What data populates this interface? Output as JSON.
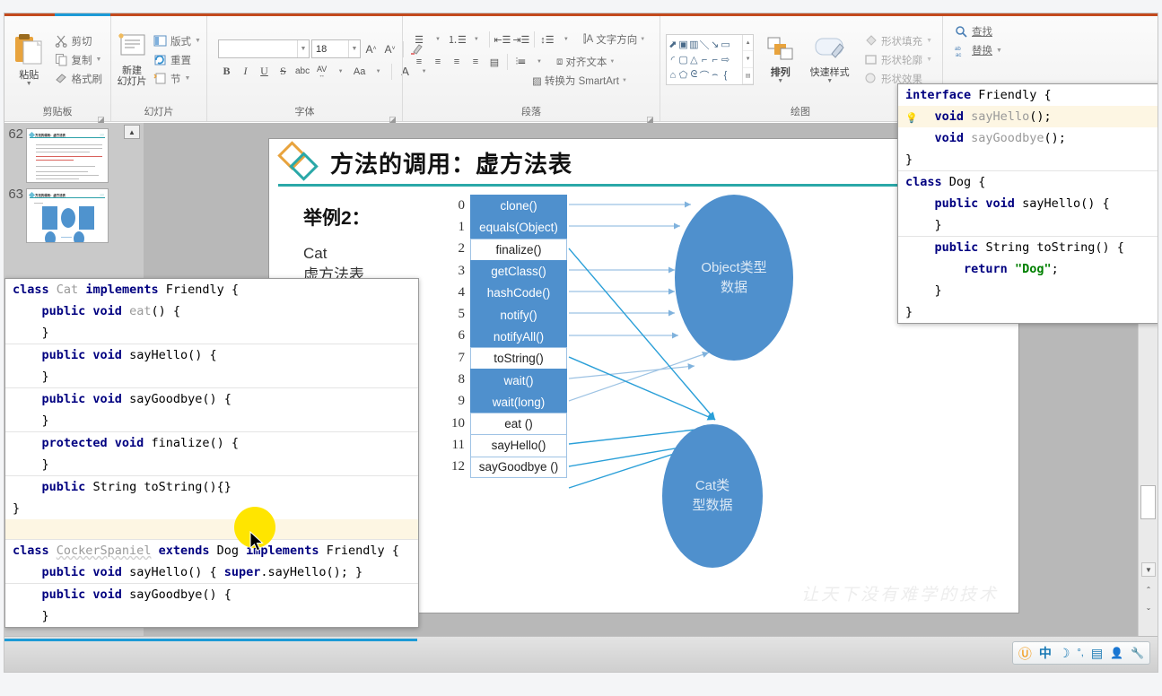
{
  "ribbon": {
    "groups": [
      {
        "name": "clipboard",
        "label": "剪贴板",
        "paste": {
          "label": "粘贴",
          "icon": "clipboard-icon"
        },
        "items": [
          {
            "label": "剪切",
            "icon": "scissors-icon",
            "has_caret": false
          },
          {
            "label": "复制",
            "icon": "copy-icon",
            "has_caret": true
          },
          {
            "label": "格式刷",
            "icon": "format-painter-icon",
            "has_caret": false
          }
        ]
      },
      {
        "name": "slides",
        "label": "幻灯片",
        "new_slide": {
          "label": "新建\n幻灯片",
          "icon": "new-slide-icon"
        },
        "items": [
          {
            "label": "版式",
            "icon": "layout-icon",
            "has_caret": true
          },
          {
            "label": "重置",
            "icon": "reset-icon",
            "has_caret": false
          },
          {
            "label": "节",
            "icon": "section-icon",
            "has_caret": true
          }
        ]
      },
      {
        "name": "font",
        "label": "字体",
        "font_name": "",
        "font_size": "18",
        "buttons_row1": [
          "A˄",
          "A˅",
          "✀"
        ],
        "buttons_row2": [
          "B",
          "I",
          "U",
          "S",
          "abc",
          "AV",
          "Aa",
          "A"
        ]
      },
      {
        "name": "paragraph",
        "label": "段落",
        "text_direction": "文字方向",
        "align_text": "对齐文本",
        "convert_smartart": "转换为 SmartArt"
      },
      {
        "name": "drawing",
        "label": "绘图",
        "arrange": "排列",
        "quick_styles": "快速样式",
        "shape_fill": "形状填充",
        "shape_outline": "形状轮廓",
        "shape_effects": "形状效果"
      },
      {
        "name": "editing",
        "find": "查找",
        "replace": "替换"
      }
    ]
  },
  "thumbnails": [
    {
      "number": "62",
      "title": "方法的调用：虚方法表",
      "kind": "text"
    },
    {
      "number": "63",
      "title": "方法的调用：虚方法表",
      "kind": "diagram"
    }
  ],
  "slide": {
    "title": "方法的调用：虚方法表",
    "example_label": "举例2：",
    "example_sub": "Cat\n虚方法表",
    "watermark": "让天下没有难学的技术",
    "vtable": [
      {
        "index": "0",
        "name": "clone()",
        "filled": true
      },
      {
        "index": "1",
        "name": "equals(Object)",
        "filled": true
      },
      {
        "index": "2",
        "name": "finalize()",
        "filled": false
      },
      {
        "index": "3",
        "name": "getClass()",
        "filled": true
      },
      {
        "index": "4",
        "name": "hashCode()",
        "filled": true
      },
      {
        "index": "5",
        "name": "notify()",
        "filled": true
      },
      {
        "index": "6",
        "name": "notifyAll()",
        "filled": true
      },
      {
        "index": "7",
        "name": "toString()",
        "filled": false
      },
      {
        "index": "8",
        "name": "wait()",
        "filled": true
      },
      {
        "index": "9",
        "name": "wait(long)",
        "filled": true
      },
      {
        "index": "10",
        "name": "eat ()",
        "filled": false
      },
      {
        "index": "11",
        "name": "sayHello()",
        "filled": false
      },
      {
        "index": "12",
        "name": "sayGoodbye ()",
        "filled": false
      }
    ],
    "ellipse_object": "Object类型\n数据",
    "ellipse_cat": "Cat类\n型数据",
    "accent_color": "#4f90cd",
    "title_rule_color": "#2aa8a8"
  },
  "popup_left": {
    "lines": [
      "class Cat implements Friendly {",
      "    public void eat() {",
      "    }",
      "    public void sayHello() {",
      "    }",
      "    public void sayGoodbye() {",
      "    }",
      "    protected void finalize() {",
      "    }",
      "    public String toString(){}",
      "}",
      "class CockerSpaniel extends Dog implements Friendly {",
      "    public void sayHello() { super.sayHello(); }",
      "    public void sayGoodbye() {",
      "    }"
    ]
  },
  "popup_right": {
    "lines": [
      "interface Friendly {",
      "    void sayHello();",
      "    void sayGoodbye();",
      "}",
      "class Dog {",
      "    public void sayHello() {",
      "    }",
      "    public String toString() {",
      "        return \"Dog\";",
      "    }",
      "}"
    ]
  },
  "status_bar": {
    "ime_items": [
      {
        "name": "sogou-logo-icon",
        "glyph": "Ⓤ"
      },
      {
        "name": "chinese-mode-icon",
        "glyph": "中"
      },
      {
        "name": "moon-icon",
        "glyph": "☽"
      },
      {
        "name": "punctuation-icon",
        "glyph": "°,"
      },
      {
        "name": "keyboard-icon",
        "glyph": "▤"
      },
      {
        "name": "user-icon",
        "glyph": "👤"
      },
      {
        "name": "tools-icon",
        "glyph": "🔧"
      }
    ]
  }
}
